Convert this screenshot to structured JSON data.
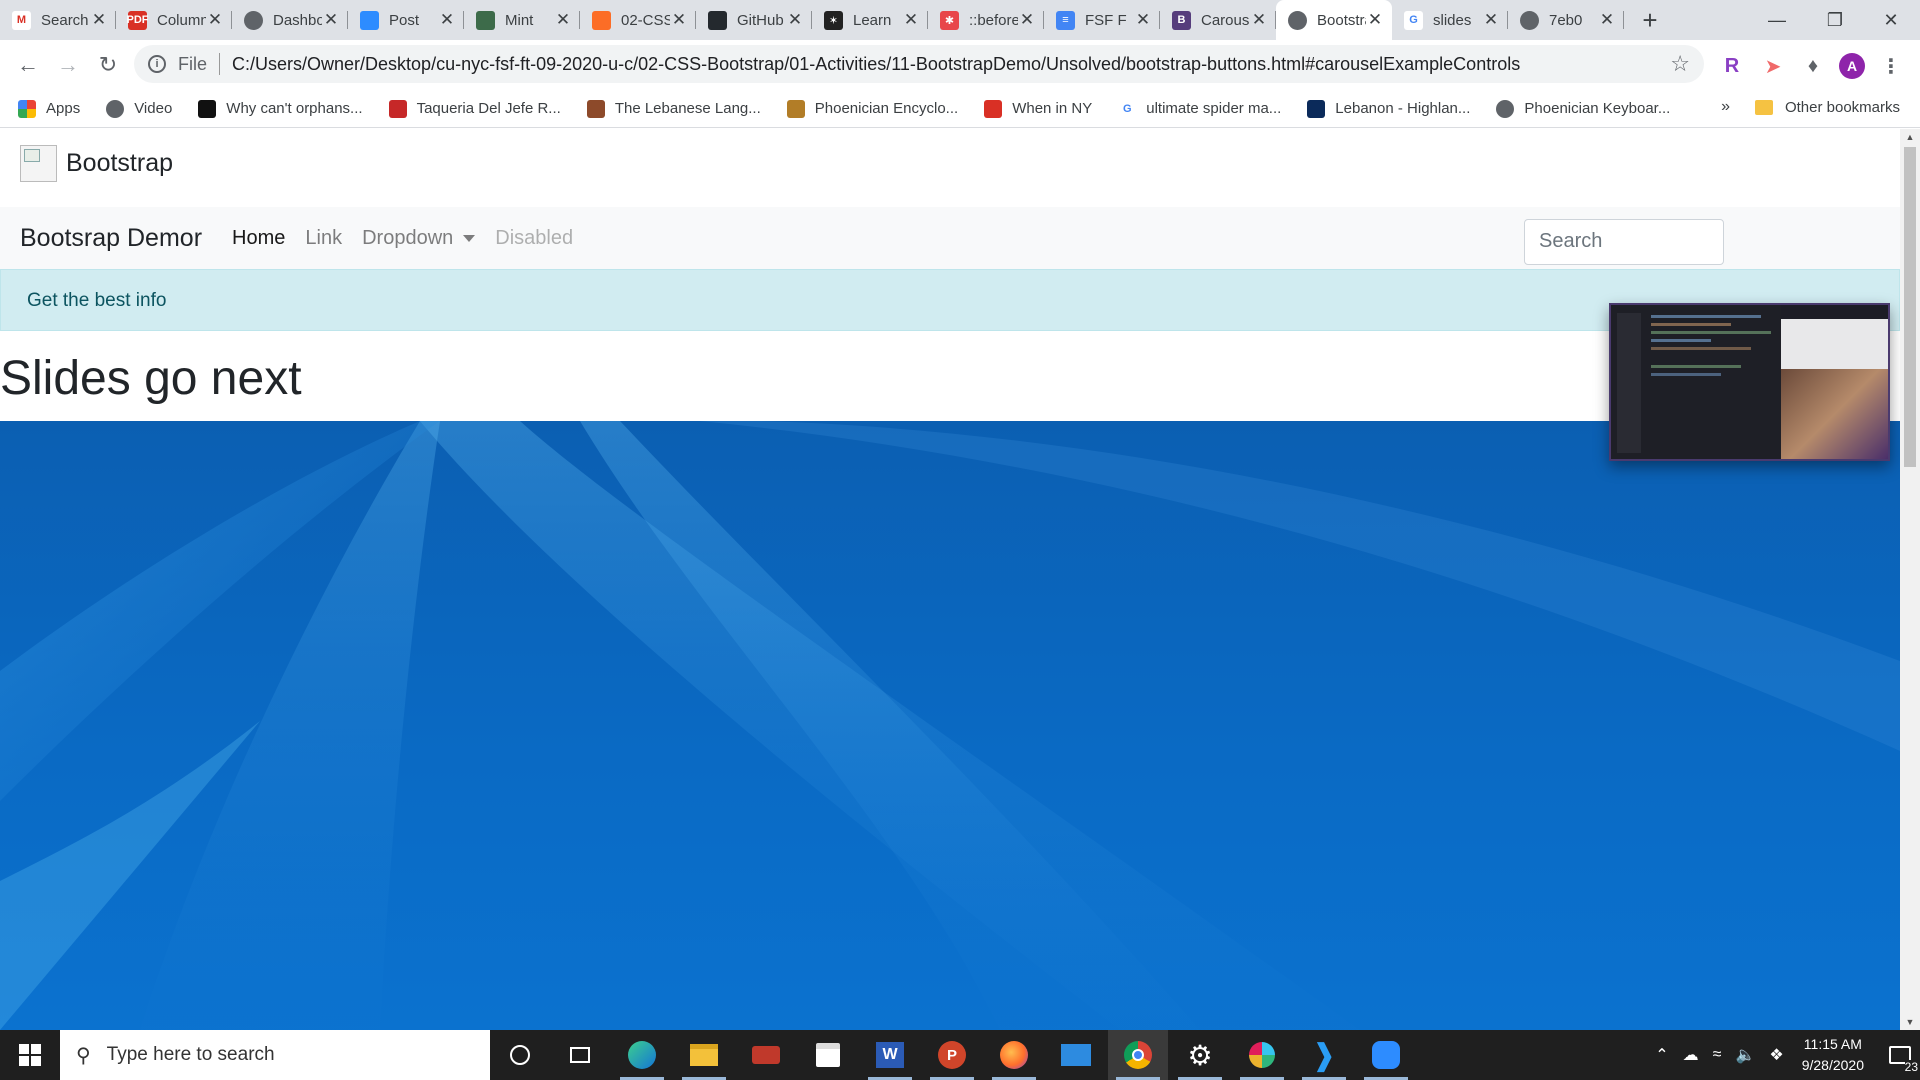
{
  "browser": {
    "tabs": [
      {
        "title": "Search",
        "icon": "gmail-icon"
      },
      {
        "title": "Column",
        "icon": "pdf-icon"
      },
      {
        "title": "Dashboard",
        "icon": "globe-icon"
      },
      {
        "title": "Post",
        "icon": "zoom-icon"
      },
      {
        "title": "Mint",
        "icon": "mint-icon"
      },
      {
        "title": "02-CSS",
        "icon": "gitlab-icon"
      },
      {
        "title": "GitHub",
        "icon": "github-icon"
      },
      {
        "title": "Learn",
        "icon": "learn-icon"
      },
      {
        "title": "::before",
        "icon": "css-tricks-icon"
      },
      {
        "title": "FSF F",
        "icon": "docs-icon"
      },
      {
        "title": "Carousel",
        "icon": "bootstrap-icon"
      },
      {
        "title": "Bootstrap",
        "icon": "globe-icon",
        "active": true
      },
      {
        "title": "slides",
        "icon": "google-icon"
      },
      {
        "title": "7eb0",
        "icon": "globe-icon"
      }
    ],
    "new_tab": "+",
    "omnibox": {
      "scheme_label": "File",
      "url": "C:/Users/Owner/Desktop/cu-nyc-fsf-ft-09-2020-u-c/02-CSS-Bootstrap/01-Activities/11-BootstrapDemo/Unsolved/bootstrap-buttons.html#carouselExampleControls"
    },
    "profile_initial": "A",
    "bookmarks": [
      {
        "label": "Apps",
        "icon": "apps-grid-icon"
      },
      {
        "label": "Video",
        "icon": "globe-icon"
      },
      {
        "label": "Why can't orphans...",
        "icon": "bookmark-site-icon"
      },
      {
        "label": "Taqueria Del Jefe R...",
        "icon": "bookmark-site-icon"
      },
      {
        "label": "The Lebanese Lang...",
        "icon": "bookmark-site-icon"
      },
      {
        "label": "Phoenician Encyclo...",
        "icon": "bookmark-site-icon"
      },
      {
        "label": "When in NY",
        "icon": "bookmark-site-icon"
      },
      {
        "label": "ultimate spider ma...",
        "icon": "google-icon"
      },
      {
        "label": "Lebanon - Highlan...",
        "icon": "bookmark-site-icon"
      },
      {
        "label": "Phoenician Keyboar...",
        "icon": "globe-icon"
      }
    ],
    "more_bookmarks": "»",
    "other_bookmarks": "Other bookmarks"
  },
  "page": {
    "brand_text": "Bootstrap",
    "navbar_brand": "Bootsrap Demor",
    "nav_links": [
      {
        "label": "Home",
        "state": "active"
      },
      {
        "label": "Link",
        "state": "normal"
      },
      {
        "label": "Dropdown",
        "state": "dropdown"
      },
      {
        "label": "Disabled",
        "state": "disabled"
      }
    ],
    "search_placeholder": "Search",
    "alert_text": "Get the best info",
    "heading": "Slides go next"
  },
  "taskbar": {
    "search_placeholder": "Type here to search",
    "time": "11:15 AM",
    "date": "9/28/2020",
    "notification_count": "23"
  },
  "colors": {
    "alert_bg": "#d1ecf1",
    "alert_text": "#0c5460",
    "navbar_bg": "#f8f9fa",
    "wallpaper_blue": "#0b64bb"
  }
}
